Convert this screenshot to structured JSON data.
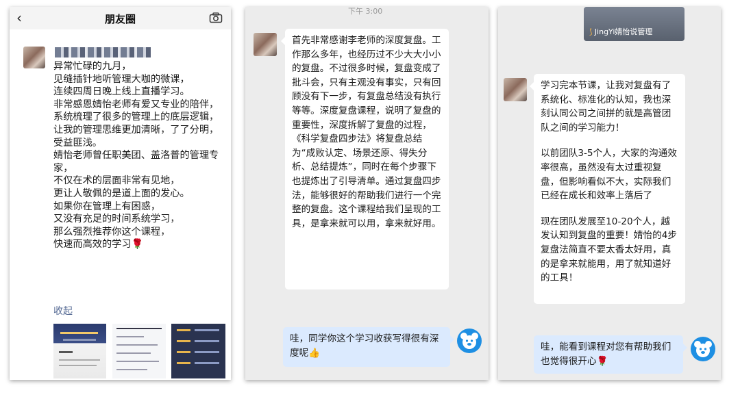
{
  "moments": {
    "back_icon": "chevron-left",
    "title": "朋友圈",
    "camera_icon": "camera",
    "post_lines": [
      "异常忙碌的九月，",
      "见缝插针地听管理大咖的微课，",
      "连续四周日晚上线上直播学习。",
      "非常感恩婧怡老师有爱又专业的陪伴，",
      "系统梳理了很多的管理上的底层逻辑，",
      "让我的管理思维更加清晰，了了分明，",
      "受益匪浅。",
      "婧怡老师曾任职美团、盖洛普的管理专家，",
      "不仅在术的层面非常有见地，",
      "更让人敬佩的是道上面的发心。",
      "如果你在管理上有困惑，",
      "又没有充足的时间系统学习，",
      "那么强烈推荐你这个课程，",
      "快速而高效的学习🌹"
    ],
    "collapse_label": "收起"
  },
  "chat_middle": {
    "time": "下午 3:00",
    "student_message": "首先非常感谢李老师的深度复盘。工作那么多年，也经历过不少大大小小的复盘。不过很多时候，复盘变成了批斗会，只有主观没有事实，只有回顾没有下一步，有复盘总结没有执行等等。深度复盘课程，说明了复盘的重要性，深度拆解了复盘的过程，《科学复盘四步法》将复盘总结为“成败认定、场景还原、得失分析、总结提炼”，同时在每个步骤下也提炼出了引导清单。通过复盘四步法，能够很好的帮助我们进行一个完整的复盘。这个课程给我们呈现的工具，是拿来就可以用，拿来就好用。",
    "reply": "哇，同学你这个学习收获写得很有深度呢👍"
  },
  "chat_right": {
    "card_caption": "JingYi婧怡说管理",
    "student_paragraphs": [
      "学习完本节课，让我对复盘有了系统化、标准化的认知，我也深刻认同公司之间拼的就是高管团队之间的学习能力！",
      "以前团队3-5个人，大家的沟通效率很高，虽然没有太过重视复盘，但影响看似不大，实际我们已经在成长和效率上落后了",
      "现在团队发展至10-20个人，越发认知到复盘的重要！婧怡的4步复盘法简直不要太香太好用，真的是拿来就能用，用了就知道好的工具！"
    ],
    "reply": "哇，能看到课程对您有帮助我们也觉得很开心🌹"
  },
  "colors": {
    "link_blue": "#576b95",
    "reply_bubble": "#dbeafe",
    "chat_bg": "#ececec",
    "bear_avatar": "#1e8fe3"
  }
}
